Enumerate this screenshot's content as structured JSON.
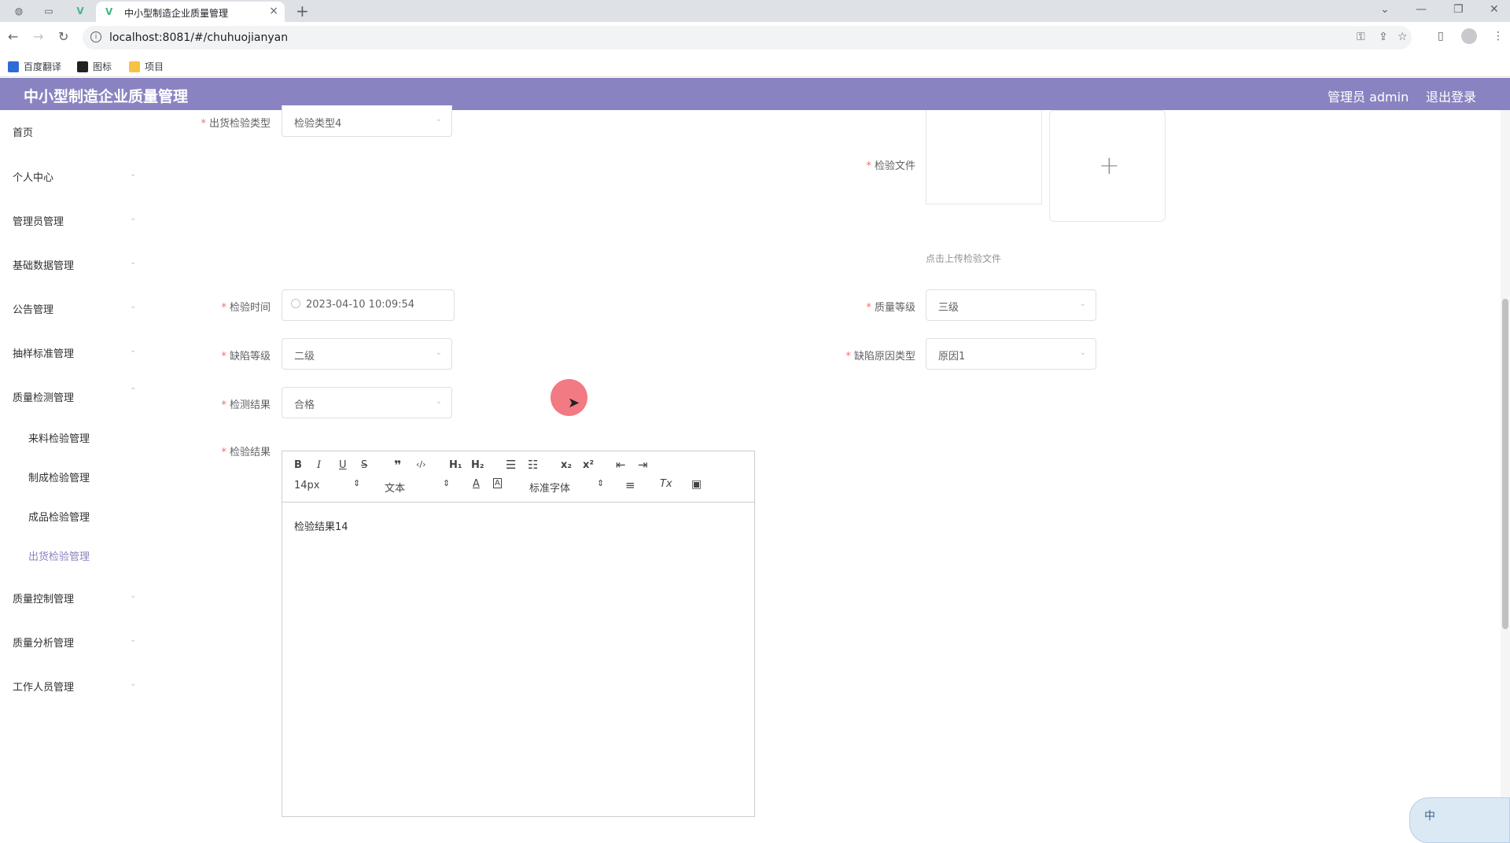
{
  "browser": {
    "tab_title": "中小型制造企业质量管理",
    "close_tab": "×",
    "new_tab": "+",
    "url": "localhost:8081/#/chuhuojianyan",
    "bookmarks": [
      "百度翻译",
      "图标",
      "项目"
    ]
  },
  "header": {
    "title": "中小型制造企业质量管理",
    "user": "管理员 admin",
    "logout": "退出登录"
  },
  "sidebar": {
    "items": [
      "首页",
      "个人中心",
      "管理员管理",
      "基础数据管理",
      "公告管理",
      "抽样标准管理",
      "质量检测管理",
      "质量控制管理",
      "质量分析管理",
      "工作人员管理"
    ],
    "sub_items": [
      "来料检验管理",
      "制成检验管理",
      "成品检验管理",
      "出货检验管理"
    ],
    "active_sub": "出货检验管理"
  },
  "form": {
    "required_mark": "*",
    "ship_type_label": "出货检验类型",
    "ship_type_value": "检验类型4",
    "inspect_file_label": "检验文件",
    "upload_tip": "点击上传检验文件",
    "inspect_time_label": "检验时间",
    "inspect_time_value": "2023-04-10 10:09:54",
    "quality_level_label": "质量等级",
    "quality_level_value": "三级",
    "defect_level_label": "缺陷等级",
    "defect_level_value": "二级",
    "defect_reason_label": "缺陷原因类型",
    "defect_reason_value": "原因1",
    "detect_result_label": "检测结果",
    "detect_result_value": "合格",
    "inspect_result_label": "检验结果",
    "editor_content": "检验结果14"
  },
  "editor_toolbar": {
    "font_size": "14px",
    "header_select": "文本",
    "font_family": "标准字体"
  },
  "ime": {
    "label": "中"
  }
}
